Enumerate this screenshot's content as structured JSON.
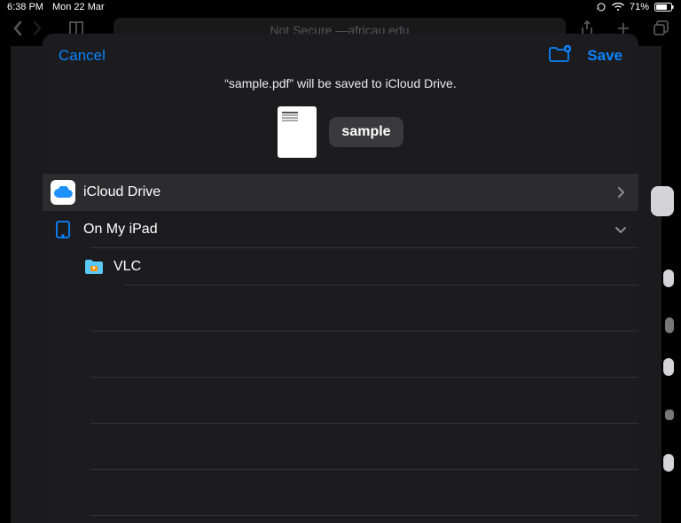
{
  "statusbar": {
    "time": "6:38 PM",
    "date": "Mon 22 Mar",
    "battery_pct": "71%"
  },
  "toolbar": {
    "addr_prefix": "Not Secure — ",
    "addr_host": "africau.edu"
  },
  "sheet": {
    "cancel": "Cancel",
    "save": "Save",
    "subtitle": "“sample.pdf” will be saved to iCloud Drive.",
    "filename": "sample"
  },
  "locations": [
    {
      "id": "icloud",
      "label": "iCloud Drive",
      "selected": true,
      "expandable": false,
      "indent": 0
    },
    {
      "id": "ipad",
      "label": "On My iPad",
      "selected": false,
      "expandable": true,
      "expanded": true,
      "indent": 0
    },
    {
      "id": "vlc",
      "label": "VLC",
      "selected": false,
      "expandable": false,
      "indent": 1
    }
  ]
}
